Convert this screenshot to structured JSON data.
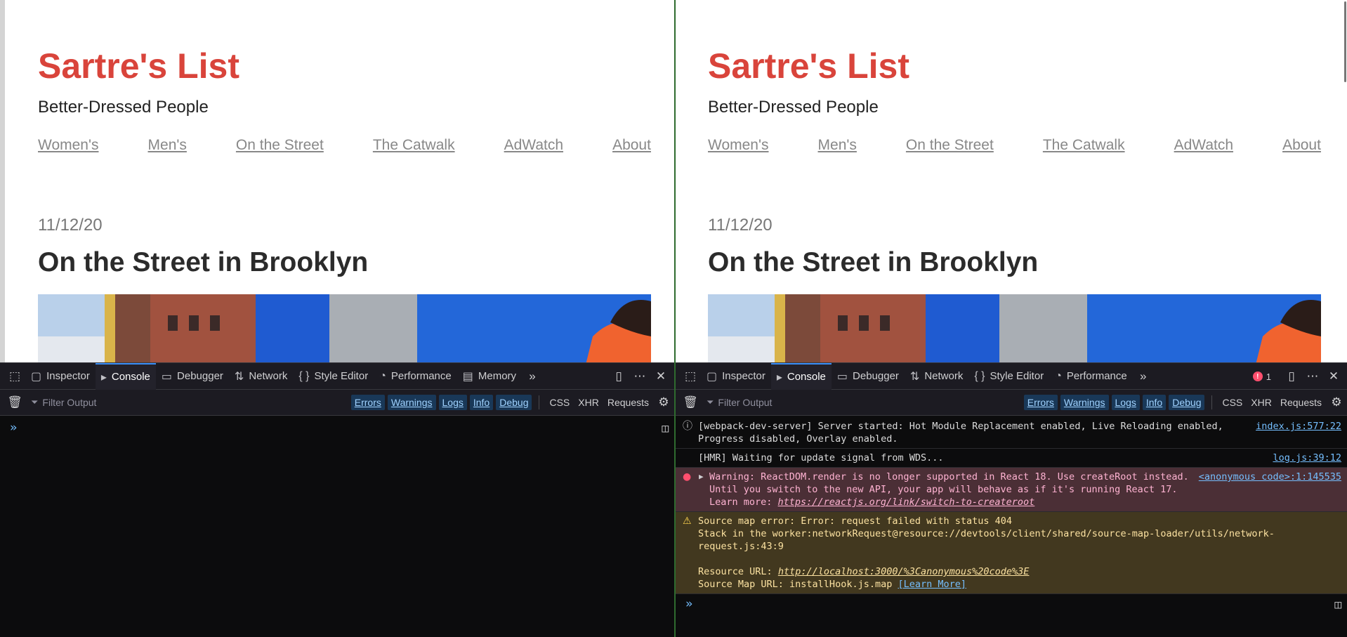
{
  "site": {
    "title": "Sartre's List",
    "tagline": "Better-Dressed People",
    "nav": [
      "Women's",
      "Men's",
      "On the Street",
      "The Catwalk",
      "AdWatch",
      "About"
    ],
    "post_date": "11/12/20",
    "post_title": "On the Street in Brooklyn"
  },
  "devtools": {
    "tabs_left": [
      "Inspector",
      "Console",
      "Debugger",
      "Network",
      "Style Editor",
      "Performance",
      "Memory"
    ],
    "tabs_right": [
      "Inspector",
      "Console",
      "Debugger",
      "Network",
      "Style Editor",
      "Performance"
    ],
    "selected_tab": "Console",
    "error_count": "1",
    "filter_placeholder": "Filter Output",
    "filter_buttons": [
      "Errors",
      "Warnings",
      "Logs",
      "Info",
      "Debug"
    ],
    "filter_extra": [
      "CSS",
      "XHR",
      "Requests"
    ]
  },
  "messages": {
    "m1": {
      "text": "[webpack-dev-server] Server started: Hot Module Replacement enabled, Live Reloading enabled, Progress disabled, Overlay enabled.",
      "source": "index.js:577:22"
    },
    "m2": {
      "text": "[HMR] Waiting for update signal from WDS...",
      "source": "log.js:39:12"
    },
    "m3": {
      "text": "Warning: ReactDOM.render is no longer supported in React 18. Use createRoot instead. Until you switch to the new API, your app will behave as if it's running React 17. Learn more:",
      "link": "https://reactjs.org/link/switch-to-createroot",
      "source": "<anonymous code>:1:145535"
    },
    "m4": {
      "line1": "Source map error: Error: request failed with status 404",
      "line2": "Stack in the worker:networkRequest@resource://devtools/client/shared/source-map-loader/utils/network-request.js:43:9",
      "resource_label": "Resource URL:",
      "resource_url": "http://localhost:3000/%3Canonymous%20code%3E",
      "map_label": "Source Map URL: installHook.js.map",
      "learn_more": "[Learn More]"
    }
  },
  "colors": {
    "site_title": "#d9443b",
    "devtools_bg": "#0c0c0d",
    "accent": "#3a8ff7"
  }
}
